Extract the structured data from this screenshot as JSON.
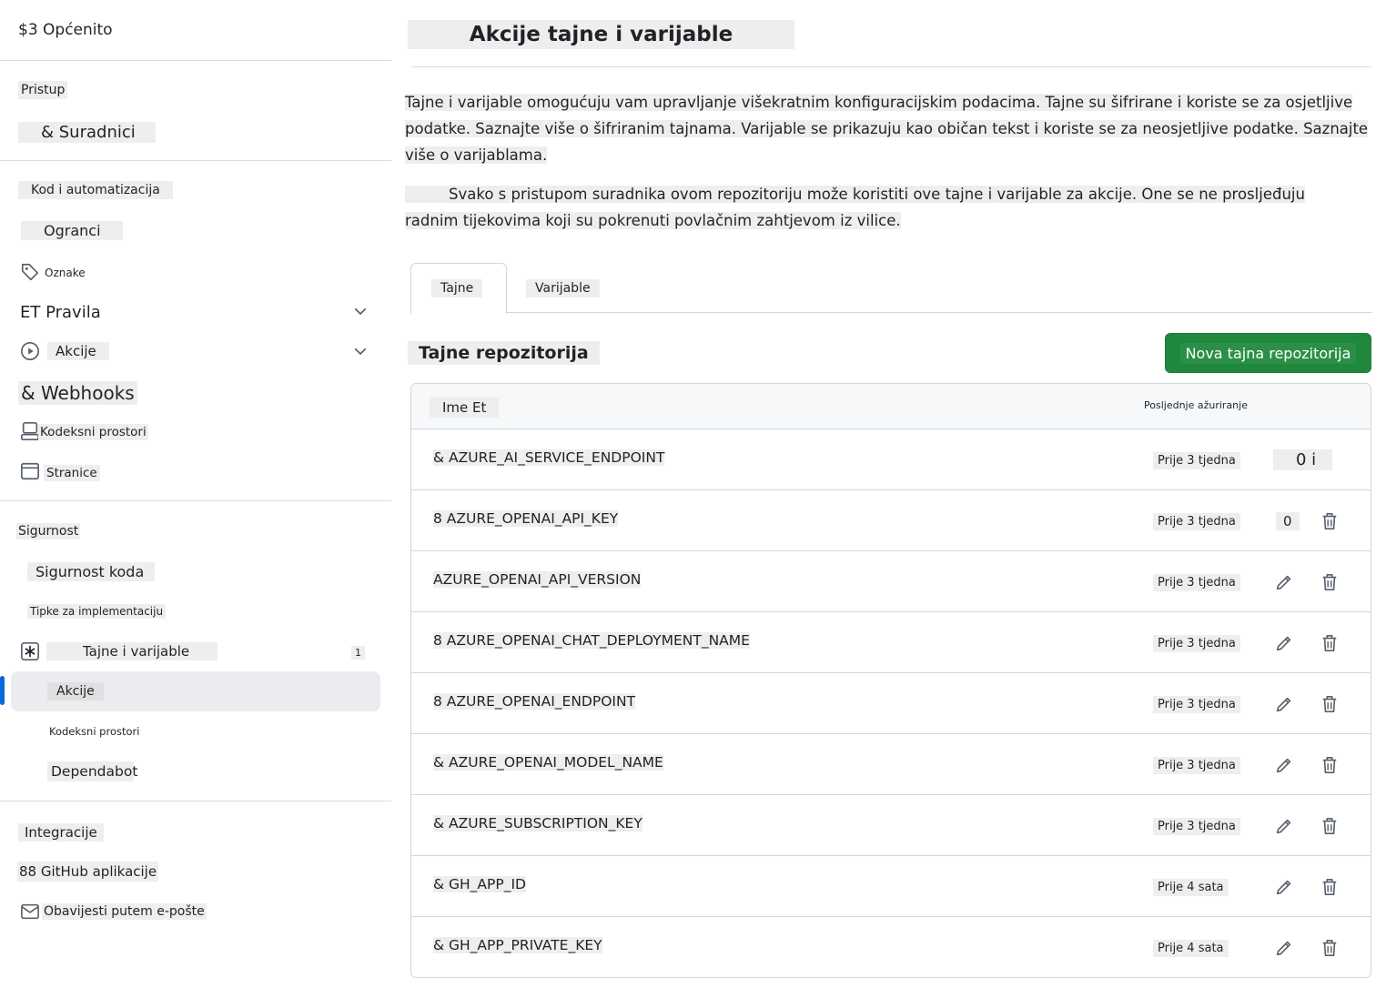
{
  "sidebar": {
    "general": "$3 Općenito",
    "access_heading": "Pristup",
    "collaborators": "& Suradnici",
    "code_automation_heading": "Kod i automatizacija",
    "branches": "Ogranci",
    "tags": "Oznake",
    "rules": "ET Pravila",
    "actions": "Akcije",
    "webhooks": "& Webhooks",
    "codespaces": "Kodeksni prostori",
    "pages": "Stranice",
    "security_heading": "Sigurnost",
    "code_security": "Sigurnost koda",
    "deploy_keys": "Tipke za implementaciju",
    "secrets_variables": "Tajne i varijable",
    "secrets_variables_count": "1",
    "sub_actions": "Akcije",
    "sub_codespaces": "Kodeksni prostori",
    "sub_dependabot": "Dependabot",
    "integrations_heading": "Integracije",
    "github_apps": "88 GitHub aplikacije",
    "email_notifications": "Obavijesti putem e-pošte"
  },
  "main": {
    "title": "Akcije tajne i varijable",
    "description": "Tajne i varijable omogućuju vam upravljanje višekratnim konfiguracijskim podacima. Tajne su šifrirane i koriste se za osjetljive podatke. Saznajte više o šifriranim tajnama. Varijable se prikazuju kao običan tekst i koriste se za neosjetljive podatke. Saznajte više o varijablama.",
    "access_note_line1": "Svako s pristupom suradnika ovom repozitoriju može koristiti ove tajne i varijable za akcije. One se ne prosljeđuju",
    "access_note_line2": "radnim tijekovima koji su pokrenuti povlačnim zahtjevom iz vilice.",
    "tabs": [
      {
        "label": "Tajne"
      },
      {
        "label": "Varijable"
      }
    ],
    "section_title": "Tajne repozitorija",
    "new_secret_button": "Nova tajna repozitorija",
    "table": {
      "col_name": "Ime Et",
      "col_updated": "Posljednje ažuriranje",
      "rows": [
        {
          "name": "& AZURE_AI_SERVICE_ENDPOINT",
          "updated": "Prije 3 tjedna",
          "status": "0 i"
        },
        {
          "name": "8   AZURE_OPENAI_API_KEY",
          "updated": "Prije 3 tjedna",
          "status": "0"
        },
        {
          "name": "AZURE_OPENAI_API_VERSION",
          "updated": "Prije 3 tjedna"
        },
        {
          "name": "8   AZURE_OPENAI_CHAT_DEPLOYMENT_NAME",
          "updated": "Prije 3 tjedna"
        },
        {
          "name": "8   AZURE_OPENAI_ENDPOINT",
          "updated": "Prije 3 tjedna"
        },
        {
          "name": "& AZURE_OPENAI_MODEL_NAME",
          "updated": "Prije 3 tjedna"
        },
        {
          "name": "& AZURE_SUBSCRIPTION_KEY",
          "updated": "Prije 3 tjedna"
        },
        {
          "name": "& GH_APP_ID",
          "updated": "Prije 4 sata"
        },
        {
          "name": "& GH_APP_PRIVATE_KEY",
          "updated": "Prije 4 sata"
        }
      ]
    }
  },
  "icons": {
    "tag": "tag-icon",
    "play": "play-circle-icon",
    "codespaces": "codespaces-icon",
    "pages": "browser-icon",
    "secret": "asterisk-box-icon",
    "mail": "mail-icon",
    "edit": "pencil-icon",
    "delete": "trash-icon",
    "chevron": "chevron-down-icon"
  },
  "colors": {
    "primary_button": "#1f883d",
    "active_indicator": "#0969da"
  }
}
